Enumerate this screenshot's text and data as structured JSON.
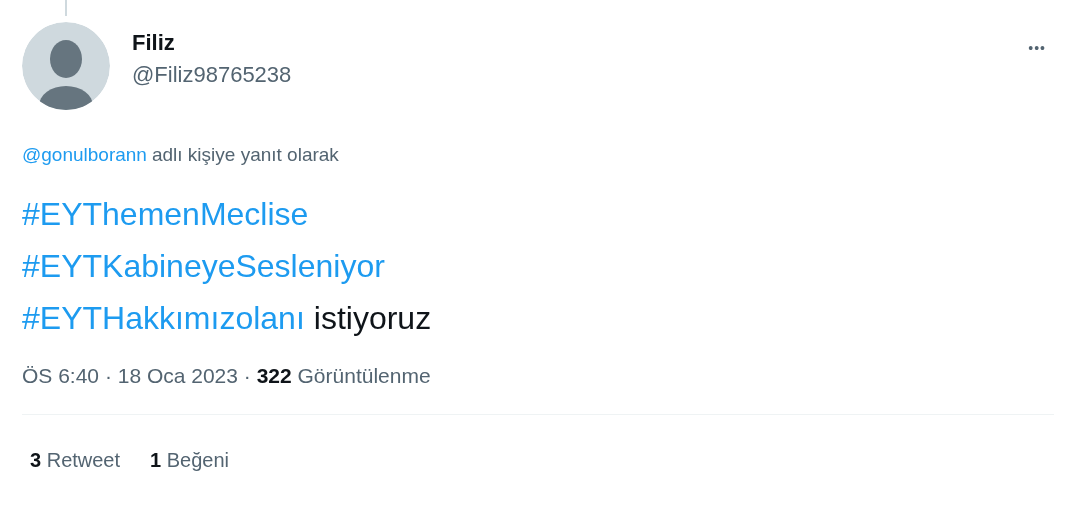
{
  "author": {
    "name": "Filiz",
    "handle": "@Filiz98765238"
  },
  "more_button": "•••",
  "reply_to": {
    "mention": "@gonulborann",
    "text": "adlı kişiye yanıt olarak"
  },
  "body": [
    [
      {
        "kind": "hashtag",
        "text": "#EYThemenMeclise"
      }
    ],
    [
      {
        "kind": "hashtag",
        "text": "#EYTKabineyeSesleniyor"
      }
    ],
    [
      {
        "kind": "hashtag",
        "text": "#EYTHakkımızolanı"
      },
      {
        "kind": "text",
        "text": "istiyoruz"
      }
    ]
  ],
  "meta": "ÖS 6:40 · 18 Oca 2023 · **322** Görüntülenme",
  "stats": [
    {
      "text": "**3** Retweet"
    },
    {
      "text": "**1** Beğeni"
    }
  ]
}
